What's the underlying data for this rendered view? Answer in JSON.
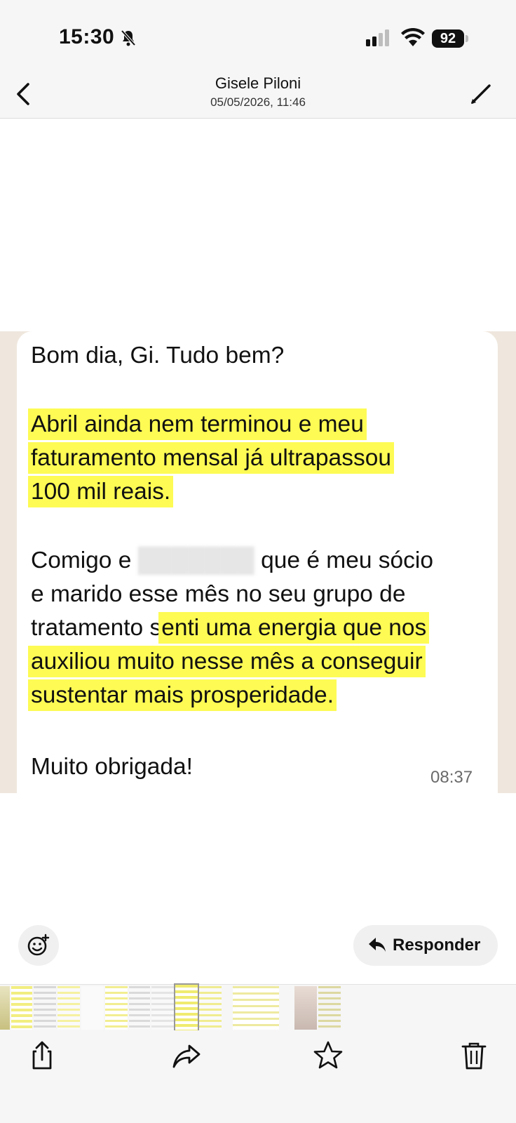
{
  "status": {
    "time": "15:30",
    "battery": "92"
  },
  "header": {
    "contact_name": "Gisele Piloni",
    "date": "05/05/2026, 11:46"
  },
  "message": {
    "line1": "Bom dia, Gi. Tudo bem?",
    "line2": "Abril ainda nem terminou e meu",
    "line3": "faturamento mensal já ultrapassou",
    "line4": "100 mil reais.",
    "line5_start": "Comigo e",
    "line5_hidden": "███████",
    "line5_end": "que é meu sócio",
    "line6": "e marido esse mês no seu grupo de",
    "line7_start": "tratamento s",
    "line7_hl": "enti uma energia que nos",
    "line8": "auxiliou muito nesse mês a conseguir",
    "line9": "sustentar mais prosperidade.",
    "line10": "Muito obrigada!",
    "time": "08:37"
  },
  "actions": {
    "reply_label": "Responder"
  },
  "icons": {
    "back": "chevron-left-icon",
    "edit": "pencil-icon",
    "reaction": "emoji-add-icon",
    "reply": "reply-arrow-icon",
    "share": "share-icon",
    "forward": "forward-icon",
    "star": "star-icon",
    "delete": "trash-icon"
  },
  "colors": {
    "highlight": "#fdfb54",
    "chat_background": "#efe7dd"
  }
}
